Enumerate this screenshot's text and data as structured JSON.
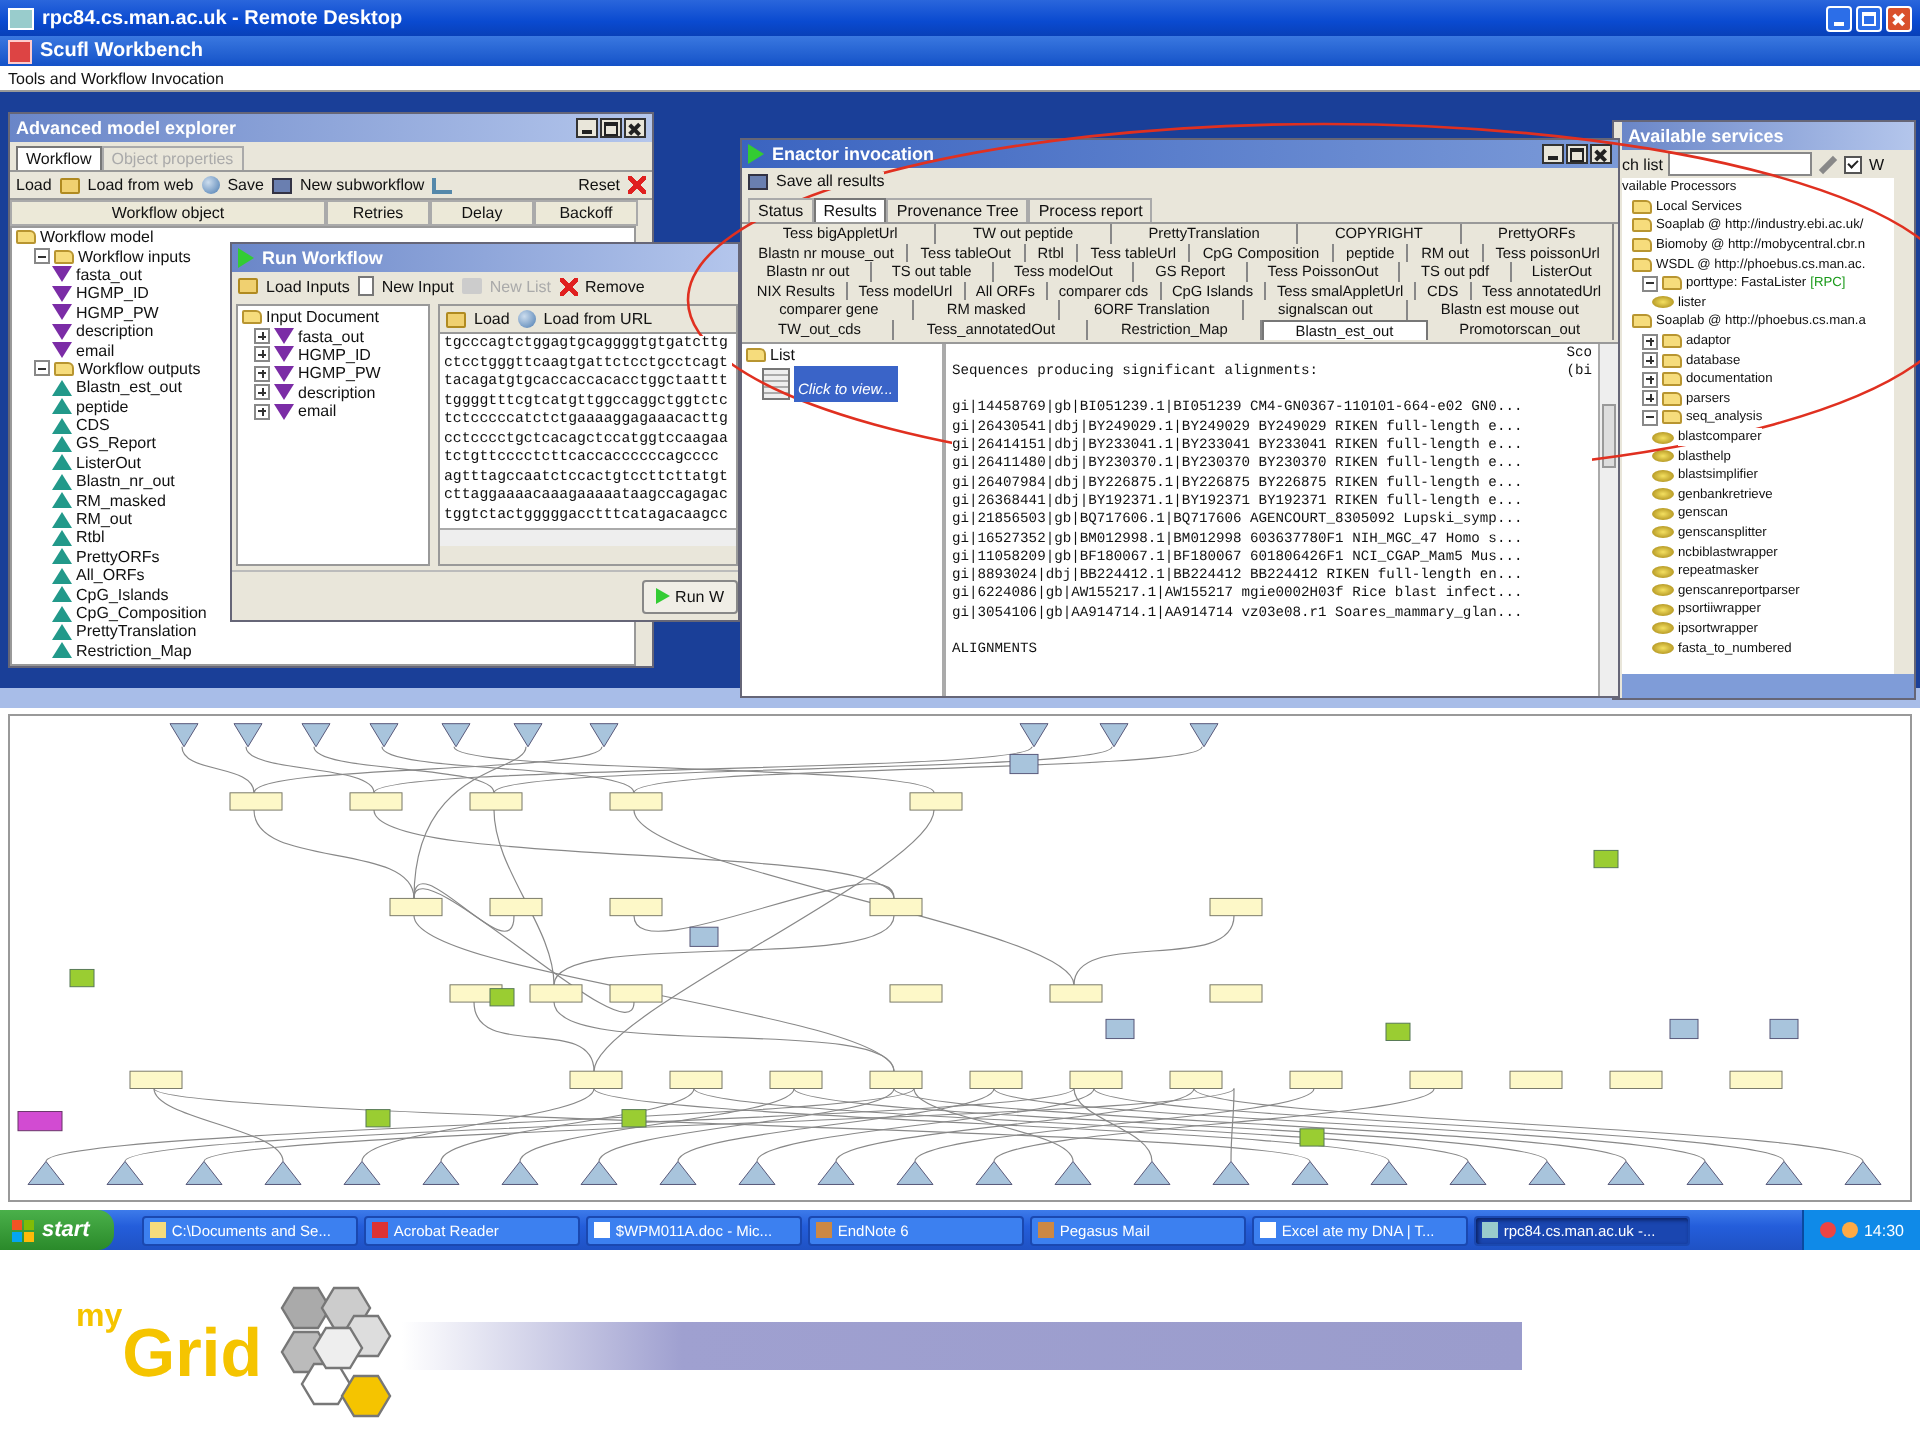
{
  "remote_desktop": {
    "title": "rpc84.cs.man.ac.uk - Remote Desktop"
  },
  "workbench": {
    "title": "Scufl Workbench",
    "menu": [
      "Tools and Workflow Invocation"
    ]
  },
  "model_explorer": {
    "title": "Advanced model explorer",
    "tabs": [
      {
        "label": "Workflow",
        "selected": true,
        "disabled": false
      },
      {
        "label": "Object properties",
        "selected": false,
        "disabled": true
      }
    ],
    "toolbar": [
      {
        "label": "Load",
        "kind": "folder"
      },
      {
        "label": "Load from web",
        "kind": "globe"
      },
      {
        "label": "Save",
        "kind": "disk"
      },
      {
        "label": "New subworkflow",
        "kind": "tree"
      }
    ],
    "reset": "Reset",
    "columns": [
      "Workflow object",
      "Retries",
      "Delay",
      "Backoff"
    ],
    "tree": [
      {
        "label": "Workflow model",
        "kind": "folder",
        "children": [
          {
            "label": "Workflow inputs",
            "kind": "folder",
            "expanded": true,
            "children": [
              {
                "label": "fasta_out",
                "kind": "input"
              },
              {
                "label": "HGMP_ID",
                "kind": "input"
              },
              {
                "label": "HGMP_PW",
                "kind": "input"
              },
              {
                "label": "description",
                "kind": "input"
              },
              {
                "label": "email",
                "kind": "input"
              }
            ]
          },
          {
            "label": "Workflow outputs",
            "kind": "folder",
            "expanded": true,
            "children": [
              {
                "label": "Blastn_est_out",
                "kind": "output"
              },
              {
                "label": "peptide",
                "kind": "output"
              },
              {
                "label": "CDS",
                "kind": "output"
              },
              {
                "label": "GS_Report",
                "kind": "output"
              },
              {
                "label": "ListerOut",
                "kind": "output"
              },
              {
                "label": "Blastn_nr_out",
                "kind": "output"
              },
              {
                "label": "RM_masked",
                "kind": "output"
              },
              {
                "label": "RM_out",
                "kind": "output"
              },
              {
                "label": "Rtbl",
                "kind": "output"
              },
              {
                "label": "PrettyORFs",
                "kind": "output"
              },
              {
                "label": "All_ORFs",
                "kind": "output"
              },
              {
                "label": "CpG_Islands",
                "kind": "output"
              },
              {
                "label": "CpG_Composition",
                "kind": "output"
              },
              {
                "label": "PrettyTranslation",
                "kind": "output"
              },
              {
                "label": "Restriction_Map",
                "kind": "output"
              }
            ]
          }
        ]
      }
    ]
  },
  "run_workflow": {
    "title": "Run Workflow",
    "toolbar": [
      {
        "label": "Load Inputs",
        "kind": "folder",
        "disabled": false
      },
      {
        "label": "New Input",
        "kind": "doc",
        "disabled": false
      },
      {
        "label": "New List",
        "kind": "list",
        "disabled": true
      },
      {
        "label": "Remove",
        "kind": "remove",
        "disabled": false
      }
    ],
    "tree": [
      {
        "label": "Input Document",
        "kind": "folder",
        "children": [
          {
            "label": "fasta_out",
            "kind": "input",
            "expanded": false
          },
          {
            "label": "HGMP_ID",
            "kind": "input",
            "expanded": false
          },
          {
            "label": "HGMP_PW",
            "kind": "input",
            "expanded": false
          },
          {
            "label": "description",
            "kind": "input",
            "expanded": false
          },
          {
            "label": "email",
            "kind": "input",
            "expanded": false
          }
        ]
      }
    ],
    "editor_toolbar": [
      {
        "label": "Load",
        "kind": "folder"
      },
      {
        "label": "Load from URL",
        "kind": "globe"
      }
    ],
    "sequence": [
      "tgcccagtctggagtgcaggggtgtgatcttg",
      "ctcctgggttcaagtgattctcctgcctcagt",
      "tacagatgtgcaccaccacacctggctaattt",
      "tggggtttcgtcatgttggccaggctggtctc",
      "tctcccccatctctgaaaaggagaaacacttg",
      "cctcccctgctcacagctccatggtccaagaa",
      "tctgttcccctcttcaccaccccccagcccc",
      "agtttagccaatctccactgtccttcttatgt",
      "cttaggaaaacaaagaaaaataagccagagac",
      "tggtctactgggggacctttcatagacaagcc"
    ],
    "run_button": "Run W"
  },
  "enactor": {
    "title": "Enactor invocation",
    "save": "Save all results",
    "tabs": [
      {
        "label": "Status",
        "selected": false
      },
      {
        "label": "Results",
        "selected": true
      },
      {
        "label": "Provenance Tree",
        "selected": false
      },
      {
        "label": "Process report",
        "selected": false
      }
    ],
    "result_tabs": [
      {
        "tabs": [
          {
            "label": "Tess bigAppletUrl",
            "selected": false
          },
          {
            "label": "TW out peptide",
            "selected": false
          },
          {
            "label": "PrettyTranslation",
            "selected": false
          },
          {
            "label": "COPYRIGHT",
            "selected": false
          },
          {
            "label": "PrettyORFs",
            "selected": false
          }
        ]
      },
      {
        "tabs": [
          {
            "label": "Blastn nr mouse_out",
            "selected": false
          },
          {
            "label": "Tess tableOut",
            "selected": false
          },
          {
            "label": "Rtbl",
            "selected": false
          },
          {
            "label": "Tess tableUrl",
            "selected": false
          },
          {
            "label": "CpG Composition",
            "selected": false
          },
          {
            "label": "peptide",
            "selected": false
          },
          {
            "label": "RM out",
            "selected": false
          },
          {
            "label": "Tess poissonUrl",
            "selected": false
          }
        ]
      },
      {
        "tabs": [
          {
            "label": "Blastn nr out",
            "selected": false
          },
          {
            "label": "TS out table",
            "selected": false
          },
          {
            "label": "Tess modelOut",
            "selected": false
          },
          {
            "label": "GS Report",
            "selected": false
          },
          {
            "label": "Tess PoissonOut",
            "selected": false
          },
          {
            "label": "TS out pdf",
            "selected": false
          },
          {
            "label": "ListerOut",
            "selected": false
          }
        ]
      },
      {
        "tabs": [
          {
            "label": "NIX Results",
            "selected": false
          },
          {
            "label": "Tess modelUrl",
            "selected": false
          },
          {
            "label": "All ORFs",
            "selected": false
          },
          {
            "label": "comparer cds",
            "selected": false
          },
          {
            "label": "CpG Islands",
            "selected": false
          },
          {
            "label": "Tess smalAppletUrl",
            "selected": false
          },
          {
            "label": "CDS",
            "selected": false
          },
          {
            "label": "Tess annotatedUrl",
            "selected": false
          }
        ]
      },
      {
        "tabs": [
          {
            "label": "comparer gene",
            "selected": false
          },
          {
            "label": "RM masked",
            "selected": false
          },
          {
            "label": "6ORF Translation",
            "selected": false
          },
          {
            "label": "signalscan out",
            "selected": false
          },
          {
            "label": "Blastn est mouse out",
            "selected": false
          }
        ]
      },
      {
        "tabs": [
          {
            "label": "TW_out_cds",
            "selected": false
          },
          {
            "label": "Tess_annotatedOut",
            "selected": false
          },
          {
            "label": "Restriction_Map",
            "selected": false
          },
          {
            "label": "Blastn_est_out",
            "selected": true
          },
          {
            "label": "Promotorscan_out",
            "selected": false
          }
        ]
      }
    ],
    "list": {
      "label": "List",
      "items": [
        {
          "label": "Click to view...",
          "selected": true
        }
      ]
    },
    "output": {
      "header_1": "Sco",
      "header_2": "(bi",
      "intro": "Sequences producing significant alignments:",
      "hits": [
        "gi|14458769|gb|BI051239.1|BI051239 CM4-GN0367-110101-664-e02 GN0...",
        "gi|26430541|dbj|BY249029.1|BY249029 BY249029 RIKEN full-length e...",
        "gi|26414151|dbj|BY233041.1|BY233041 BY233041 RIKEN full-length e...",
        "gi|26411480|dbj|BY230370.1|BY230370 BY230370 RIKEN full-length e...",
        "gi|26407984|dbj|BY226875.1|BY226875 BY226875 RIKEN full-length e...",
        "gi|26368441|dbj|BY192371.1|BY192371 BY192371 RIKEN full-length e...",
        "gi|21856503|gb|BQ717606.1|BQ717606 AGENCOURT_8305092 Lupski_symp...",
        "gi|16527352|gb|BM012998.1|BM012998 603637780F1 NIH_MGC_47 Homo s...",
        "gi|11058209|gb|BF180067.1|BF180067 601806426F1 NCI_CGAP_Mam5 Mus...",
        "gi|8893024|dbj|BB224412.1|BB224412 BB224412 RIKEN full-length en...",
        "gi|6224086|gb|AW155217.1|AW155217 mgie0002H03f Rice blast infect...",
        "gi|3054106|gb|AA914714.1|AA914714 vz03e08.r1 Soares_mammary_glan..."
      ],
      "footer": "ALIGNMENTS"
    }
  },
  "services": {
    "title": "Available services",
    "search_label": "ch list",
    "checkbox": {
      "label": "W",
      "checked": true
    },
    "tree": [
      {
        "label": "vailable Processors",
        "children": [
          {
            "label": "Local Services",
            "kind": "folder"
          },
          {
            "label": "Soaplab @ http://industry.ebi.ac.uk/",
            "kind": "folder"
          },
          {
            "label": "Biomoby @ http://mobycentral.cbr.n",
            "kind": "folder"
          },
          {
            "label": "WSDL @ http://phoebus.cs.man.ac.",
            "kind": "folder",
            "children": [
              {
                "label": "porttype: FastaLister",
                "tag": "[RPC]",
                "kind": "folder",
                "expanded": true,
                "children": [
                  {
                    "label": "lister",
                    "kind": "processor"
                  }
                ]
              }
            ]
          },
          {
            "label": "Soaplab @ http://phoebus.cs.man.a",
            "kind": "folder",
            "children": [
              {
                "label": "adaptor",
                "kind": "folder",
                "expanded": false
              },
              {
                "label": "database",
                "kind": "folder",
                "expanded": false
              },
              {
                "label": "documentation",
                "kind": "folder",
                "expanded": false
              },
              {
                "label": "parsers",
                "kind": "folder",
                "expanded": false
              },
              {
                "label": "seq_analysis",
                "kind": "folder",
                "expanded": true,
                "children": [
                  {
                    "label": "blastcomparer",
                    "kind": "processor"
                  },
                  {
                    "label": "blasthelp",
                    "kind": "processor"
                  },
                  {
                    "label": "blastsimplifier",
                    "kind": "processor"
                  },
                  {
                    "label": "genbankretrieve",
                    "kind": "processor"
                  },
                  {
                    "label": "genscan",
                    "kind": "processor"
                  },
                  {
                    "label": "genscansplitter",
                    "kind": "processor"
                  },
                  {
                    "label": "ncbiblastwrapper",
                    "kind": "processor"
                  },
                  {
                    "label": "repeatmasker",
                    "kind": "processor"
                  },
                  {
                    "label": "genscanreportparser",
                    "kind": "processor"
                  },
                  {
                    "label": "psortiiwrapper",
                    "kind": "processor"
                  },
                  {
                    "label": "ipsortwrapper",
                    "kind": "processor"
                  },
                  {
                    "label": "fasta_to_numbered",
                    "kind": "processor"
                  }
                ]
              }
            ]
          }
        ]
      }
    ]
  },
  "taskbar": {
    "start": "start",
    "items": [
      {
        "label": "C:\\Documents and Se...",
        "kind": "folder",
        "selected": false
      },
      {
        "label": "Acrobat Reader",
        "kind": "pdf",
        "selected": false
      },
      {
        "label": "$WPM011A.doc - Mic...",
        "kind": "doc",
        "selected": false
      },
      {
        "label": "EndNote 6",
        "kind": "app",
        "selected": false
      },
      {
        "label": "Pegasus Mail",
        "kind": "app",
        "selected": false
      },
      {
        "label": "Excel ate my DNA | T...",
        "kind": "doc",
        "selected": false
      },
      {
        "label": "rpc84.cs.man.ac.uk -...",
        "kind": "remote",
        "selected": true
      }
    ],
    "clock": "14:30"
  },
  "logo": {
    "my": "my",
    "grid": "Grid"
  }
}
